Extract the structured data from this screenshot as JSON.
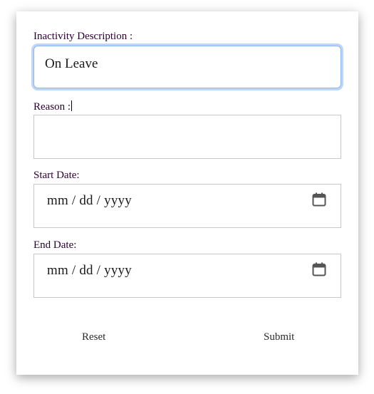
{
  "form": {
    "inactivity_description": {
      "label": "Inactivity Description :",
      "value": "On Leave"
    },
    "reason": {
      "label": "Reason :",
      "value": ""
    },
    "start_date": {
      "label": "Start Date:",
      "placeholder": "mm / dd / yyyy",
      "icon": "calendar-icon"
    },
    "end_date": {
      "label": "End Date:",
      "placeholder": "mm / dd / yyyy",
      "icon": "calendar-icon"
    },
    "reset_label": "Reset",
    "submit_label": "Submit"
  },
  "colors": {
    "label_text": "#2a0030",
    "focus_ring": "#bfd6f9",
    "border": "#c8c8c8"
  }
}
